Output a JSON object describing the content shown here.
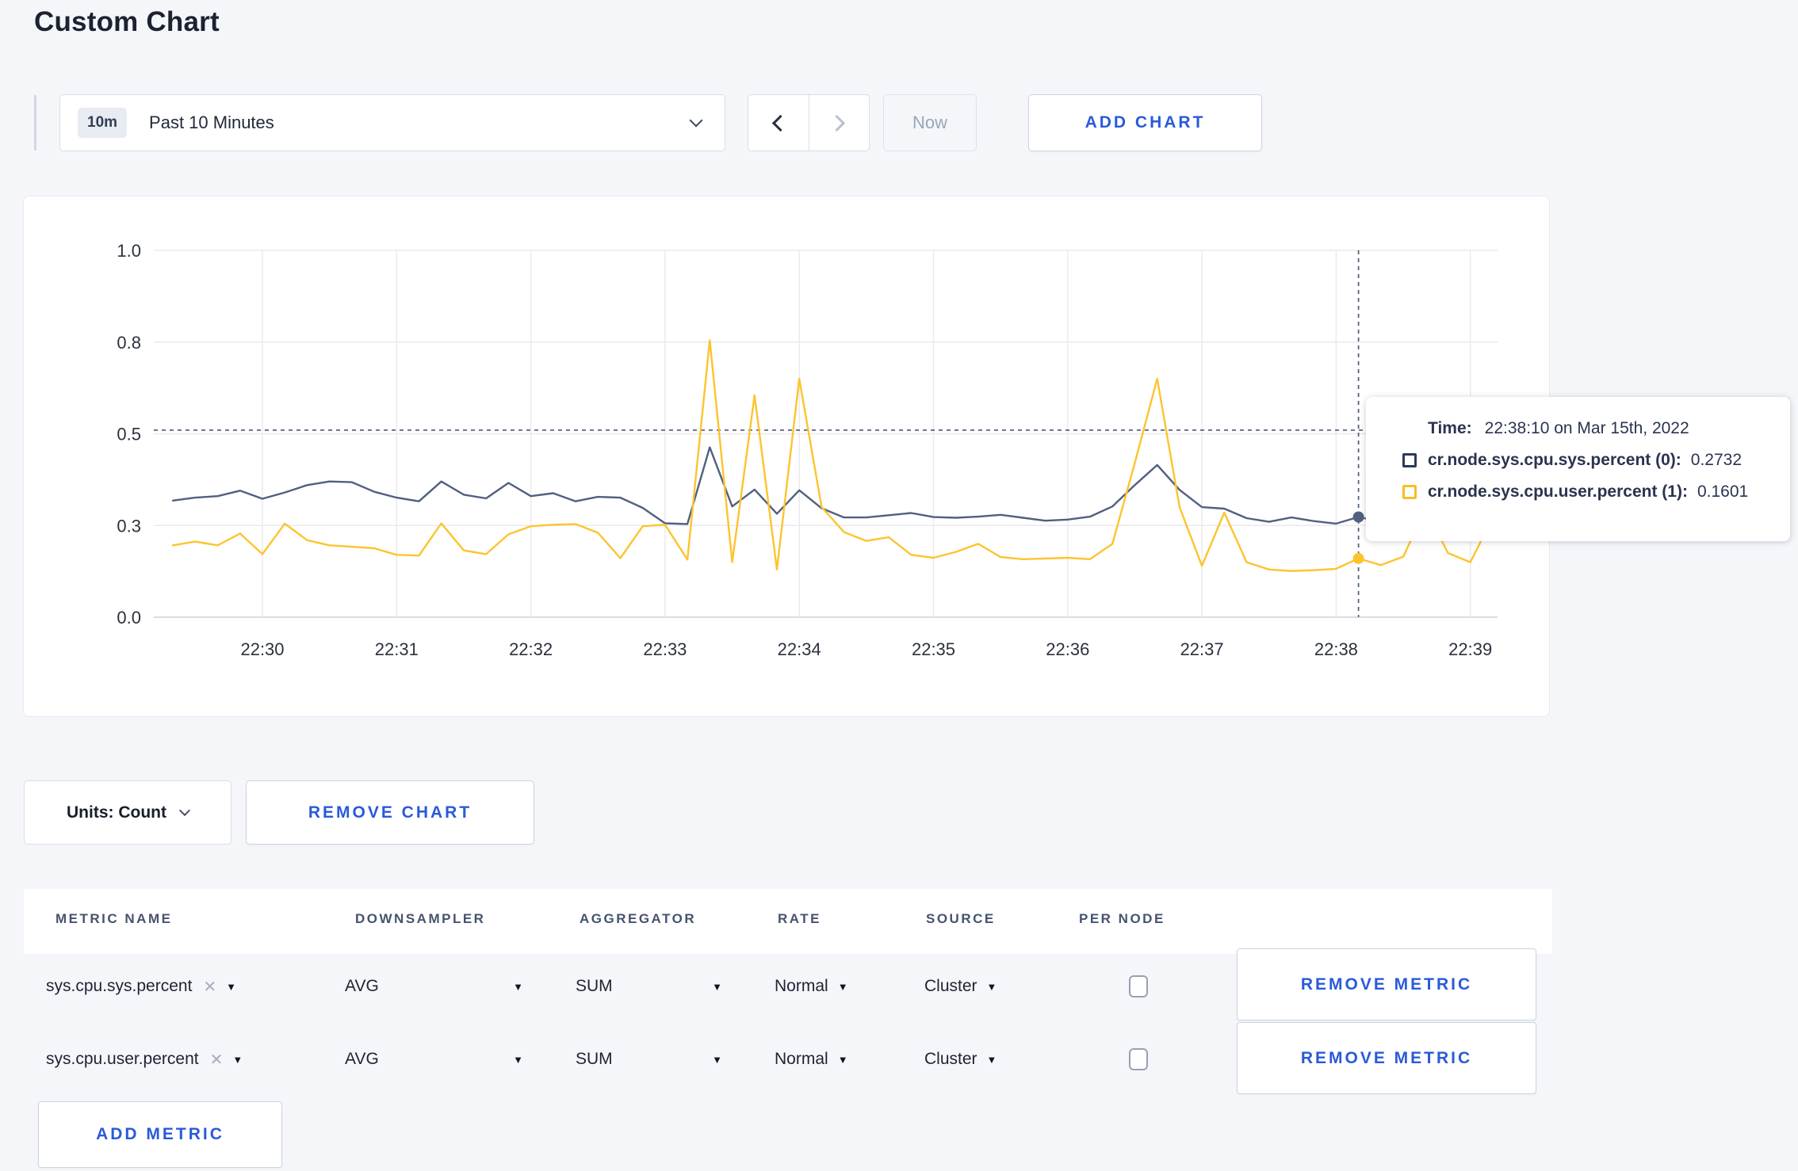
{
  "page": {
    "title": "Custom Chart"
  },
  "toolbar": {
    "time_scale_badge": "10m",
    "time_scale_label": "Past 10 Minutes",
    "now_label": "Now",
    "add_chart_label": "ADD CHART"
  },
  "chart_card": {
    "units_label": "Units: Count",
    "remove_chart_label": "REMOVE CHART"
  },
  "tooltip": {
    "time_label": "Time:",
    "time_value": "22:38:10 on Mar 15th, 2022",
    "series": [
      {
        "name": "cr.node.sys.cpu.sys.percent (0):",
        "value": "0.2732",
        "color": "#2c3a57"
      },
      {
        "name": "cr.node.sys.cpu.user.percent (1):",
        "value": "0.1601",
        "color": "#f6be26"
      }
    ]
  },
  "chart_data": {
    "type": "line",
    "title": "",
    "xlabel": "",
    "ylabel": "",
    "ylim": [
      0,
      1
    ],
    "grid": true,
    "legend_position": "tooltip",
    "x_start_time": "22:29:20",
    "x_step_seconds": 10,
    "x_ticks": [
      "22:30",
      "22:31",
      "22:32",
      "22:33",
      "22:34",
      "22:35",
      "22:36",
      "22:37",
      "22:38",
      "22:39"
    ],
    "y_ticks": [
      {
        "label": "0.0",
        "value": 0
      },
      {
        "label": "0.3",
        "value": 0.25
      },
      {
        "label": "0.5",
        "value": 0.5
      },
      {
        "label": "0.8",
        "value": 0.75
      },
      {
        "label": "1.0",
        "value": 1
      }
    ],
    "series": [
      {
        "name": "cr.node.sys.cpu.sys.percent",
        "color": "#50607e",
        "values": [
          0.318,
          0.326,
          0.33,
          0.345,
          0.323,
          0.34,
          0.36,
          0.37,
          0.368,
          0.342,
          0.326,
          0.316,
          0.37,
          0.334,
          0.324,
          0.366,
          0.33,
          0.338,
          0.316,
          0.328,
          0.326,
          0.298,
          0.256,
          0.254,
          0.463,
          0.302,
          0.348,
          0.282,
          0.346,
          0.297,
          0.272,
          0.272,
          0.278,
          0.284,
          0.273,
          0.271,
          0.274,
          0.279,
          0.271,
          0.263,
          0.266,
          0.274,
          0.302,
          0.36,
          0.415,
          0.347,
          0.3,
          0.296,
          0.27,
          0.26,
          0.272,
          0.262,
          0.255,
          0.2732,
          0.26,
          0.282,
          0.27,
          0.276,
          0.284,
          0.278
        ]
      },
      {
        "name": "cr.node.sys.cpu.user.percent",
        "color": "#fcc42e",
        "values": [
          0.196,
          0.206,
          0.196,
          0.228,
          0.172,
          0.255,
          0.21,
          0.196,
          0.192,
          0.188,
          0.17,
          0.168,
          0.256,
          0.182,
          0.172,
          0.226,
          0.248,
          0.252,
          0.254,
          0.23,
          0.161,
          0.248,
          0.252,
          0.157,
          0.755,
          0.15,
          0.605,
          0.13,
          0.65,
          0.3,
          0.232,
          0.208,
          0.218,
          0.17,
          0.162,
          0.178,
          0.2,
          0.164,
          0.158,
          0.16,
          0.162,
          0.158,
          0.2,
          0.42,
          0.65,
          0.3,
          0.14,
          0.285,
          0.15,
          0.13,
          0.126,
          0.128,
          0.132,
          0.1601,
          0.142,
          0.165,
          0.295,
          0.175,
          0.15,
          0.27
        ]
      }
    ],
    "crosshair": {
      "time": "22:38:10",
      "x_offset_seconds": 530,
      "hline_value": 0.51,
      "points": [
        {
          "series": 0,
          "value": 0.2732
        },
        {
          "series": 1,
          "value": 0.1601
        }
      ]
    }
  },
  "metrics_table": {
    "headers": [
      "METRIC NAME",
      "DOWNSAMPLER",
      "AGGREGATOR",
      "RATE",
      "SOURCE",
      "PER NODE"
    ],
    "rows": [
      {
        "metric": "sys.cpu.sys.percent",
        "downsampler": "AVG",
        "aggregator": "SUM",
        "rate": "Normal",
        "source": "Cluster",
        "per_node_checked": false,
        "remove_label": "REMOVE METRIC"
      },
      {
        "metric": "sys.cpu.user.percent",
        "downsampler": "AVG",
        "aggregator": "SUM",
        "rate": "Normal",
        "source": "Cluster",
        "per_node_checked": false,
        "remove_label": "REMOVE METRIC"
      }
    ],
    "add_metric_label": "ADD METRIC"
  },
  "colors": {
    "accent_blue": "#2a5ada",
    "navy_series": "#50607e",
    "yellow_series": "#fcc42e",
    "page_background": "#f5f6fa"
  }
}
